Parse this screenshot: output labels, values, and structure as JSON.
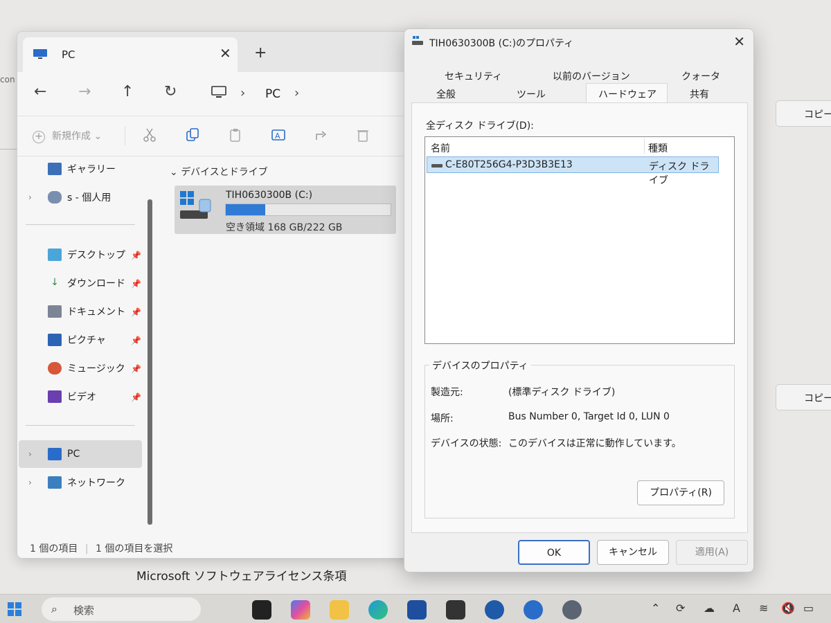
{
  "background": {
    "left_snippet": "con",
    "copy_button_label": "コピー",
    "license_text": "Microsoft ソフトウェアライセンス条項"
  },
  "explorer": {
    "tab_title": "PC",
    "breadcrumb": [
      "PC"
    ],
    "toolbar": {
      "new_label": "新規作成"
    },
    "sidebar": [
      {
        "label": "ギャラリー",
        "icon": "gallery-icon"
      },
      {
        "label": "s - 個人用",
        "icon": "onedrive-icon"
      },
      {
        "label": "デスクトップ",
        "icon": "desktop-folder-icon",
        "pinned": true
      },
      {
        "label": "ダウンロード",
        "icon": "download-icon",
        "pinned": true
      },
      {
        "label": "ドキュメント",
        "icon": "documents-icon",
        "pinned": true
      },
      {
        "label": "ピクチャ",
        "icon": "pictures-icon",
        "pinned": true
      },
      {
        "label": "ミュージック",
        "icon": "music-icon",
        "pinned": true
      },
      {
        "label": "ビデオ",
        "icon": "video-icon",
        "pinned": true
      },
      {
        "label": "PC",
        "icon": "pc-icon",
        "selected": true
      },
      {
        "label": "ネットワーク",
        "icon": "network-icon"
      }
    ],
    "group_header": "デバイスとドライブ",
    "drive": {
      "name": "TIH0630300B (C:)",
      "free_text": "空き領域 168 GB/222 GB",
      "used_fraction": 0.24
    },
    "status": {
      "count": "1 個の項目",
      "selected": "1 個の項目を選択"
    }
  },
  "dialog": {
    "title": "TIH0630300B (C:)のプロパティ",
    "tabs_row1": [
      "セキュリティ",
      "以前のバージョン",
      "クォータ"
    ],
    "tabs_row2": [
      "全般",
      "ツール",
      "ハードウェア",
      "共有"
    ],
    "active_tab": "ハードウェア",
    "all_drives_label": "全ディスク ドライブ(D):",
    "list_headers": {
      "name": "名前",
      "type": "種類"
    },
    "list_rows": [
      {
        "name": "C-E80T256G4-P3D3B3E13",
        "type": "ディスク ドライブ"
      }
    ],
    "device_props_title": "デバイスのプロパティ",
    "props": [
      {
        "key": "製造元:",
        "value": "(標準ディスク ドライブ)"
      },
      {
        "key": "場所:",
        "value": "Bus Number 0, Target Id 0, LUN 0"
      },
      {
        "key": "デバイスの状態:",
        "value": "このデバイスは正常に動作しています。"
      }
    ],
    "properties_button": "プロパティ(R)",
    "ok": "OK",
    "cancel": "キャンセル",
    "apply": "適用(A)"
  },
  "taskbar": {
    "search_placeholder": "検索"
  }
}
